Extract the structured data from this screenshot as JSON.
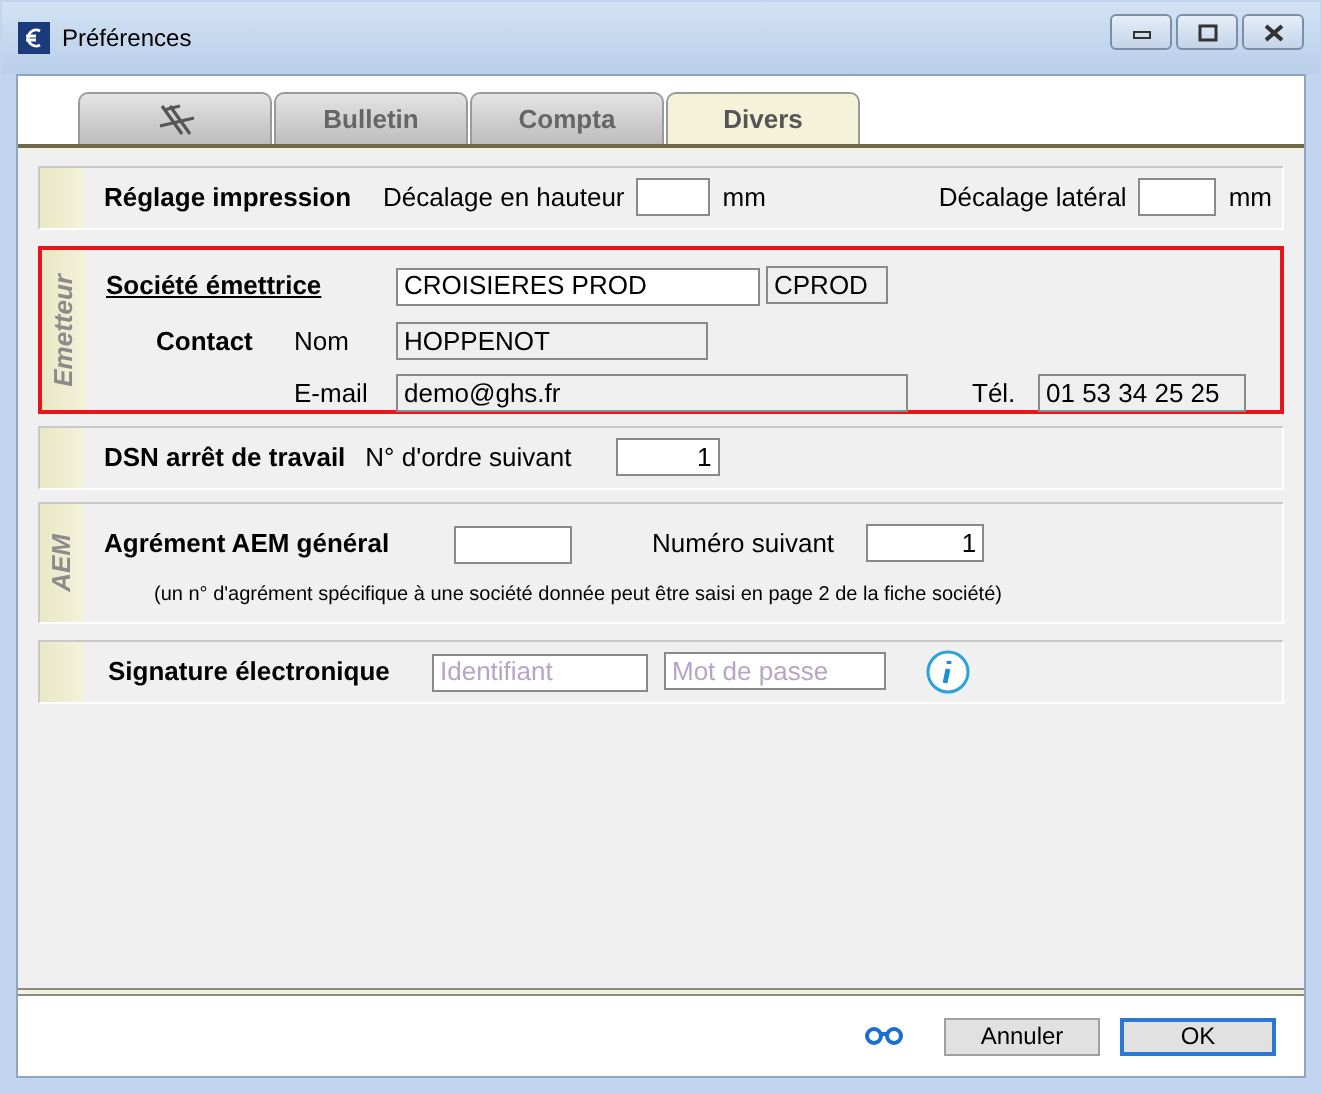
{
  "window": {
    "title": "Préférences"
  },
  "tabs": [
    {
      "kind": "icon",
      "selected": false
    },
    {
      "kind": "text",
      "label": "Bulletin",
      "selected": false
    },
    {
      "kind": "text",
      "label": "Compta",
      "selected": false
    },
    {
      "kind": "text",
      "label": "Divers",
      "selected": true
    }
  ],
  "print_settings": {
    "title": "Réglage impression",
    "vertical_label": "Décalage en hauteur",
    "vertical_unit": "mm",
    "lateral_label": "Décalage latéral",
    "lateral_unit": "mm"
  },
  "emitter": {
    "side_label": "Emetteur",
    "highlighted": true,
    "company_label": "Société émettrice",
    "company_name": "CROISIERES PROD",
    "company_code": "CPROD",
    "contact_label": "Contact",
    "name_label": "Nom",
    "name_value": "HOPPENOT",
    "email_label": "E-mail",
    "email_value": "demo@ghs.fr",
    "phone_label": "Tél.",
    "phone_value": "01 53 34 25 25"
  },
  "dsn": {
    "title": "DSN arrêt de travail",
    "order_label": "N° d'ordre suivant",
    "order_value": "1"
  },
  "aem": {
    "side_label": "AEM",
    "title": "Agrément AEM général",
    "next_label": "Numéro suivant",
    "next_value": "1",
    "note": "(un n° d'agrément spécifique à une société donnée peut être saisi en page 2 de la fiche société)"
  },
  "signature": {
    "title": "Signature électronique",
    "id_placeholder": "Identifiant",
    "password_placeholder": "Mot de passe"
  },
  "buttons": [
    {
      "label": "Annuler",
      "default": false
    },
    {
      "label": "OK",
      "default": true
    }
  ]
}
